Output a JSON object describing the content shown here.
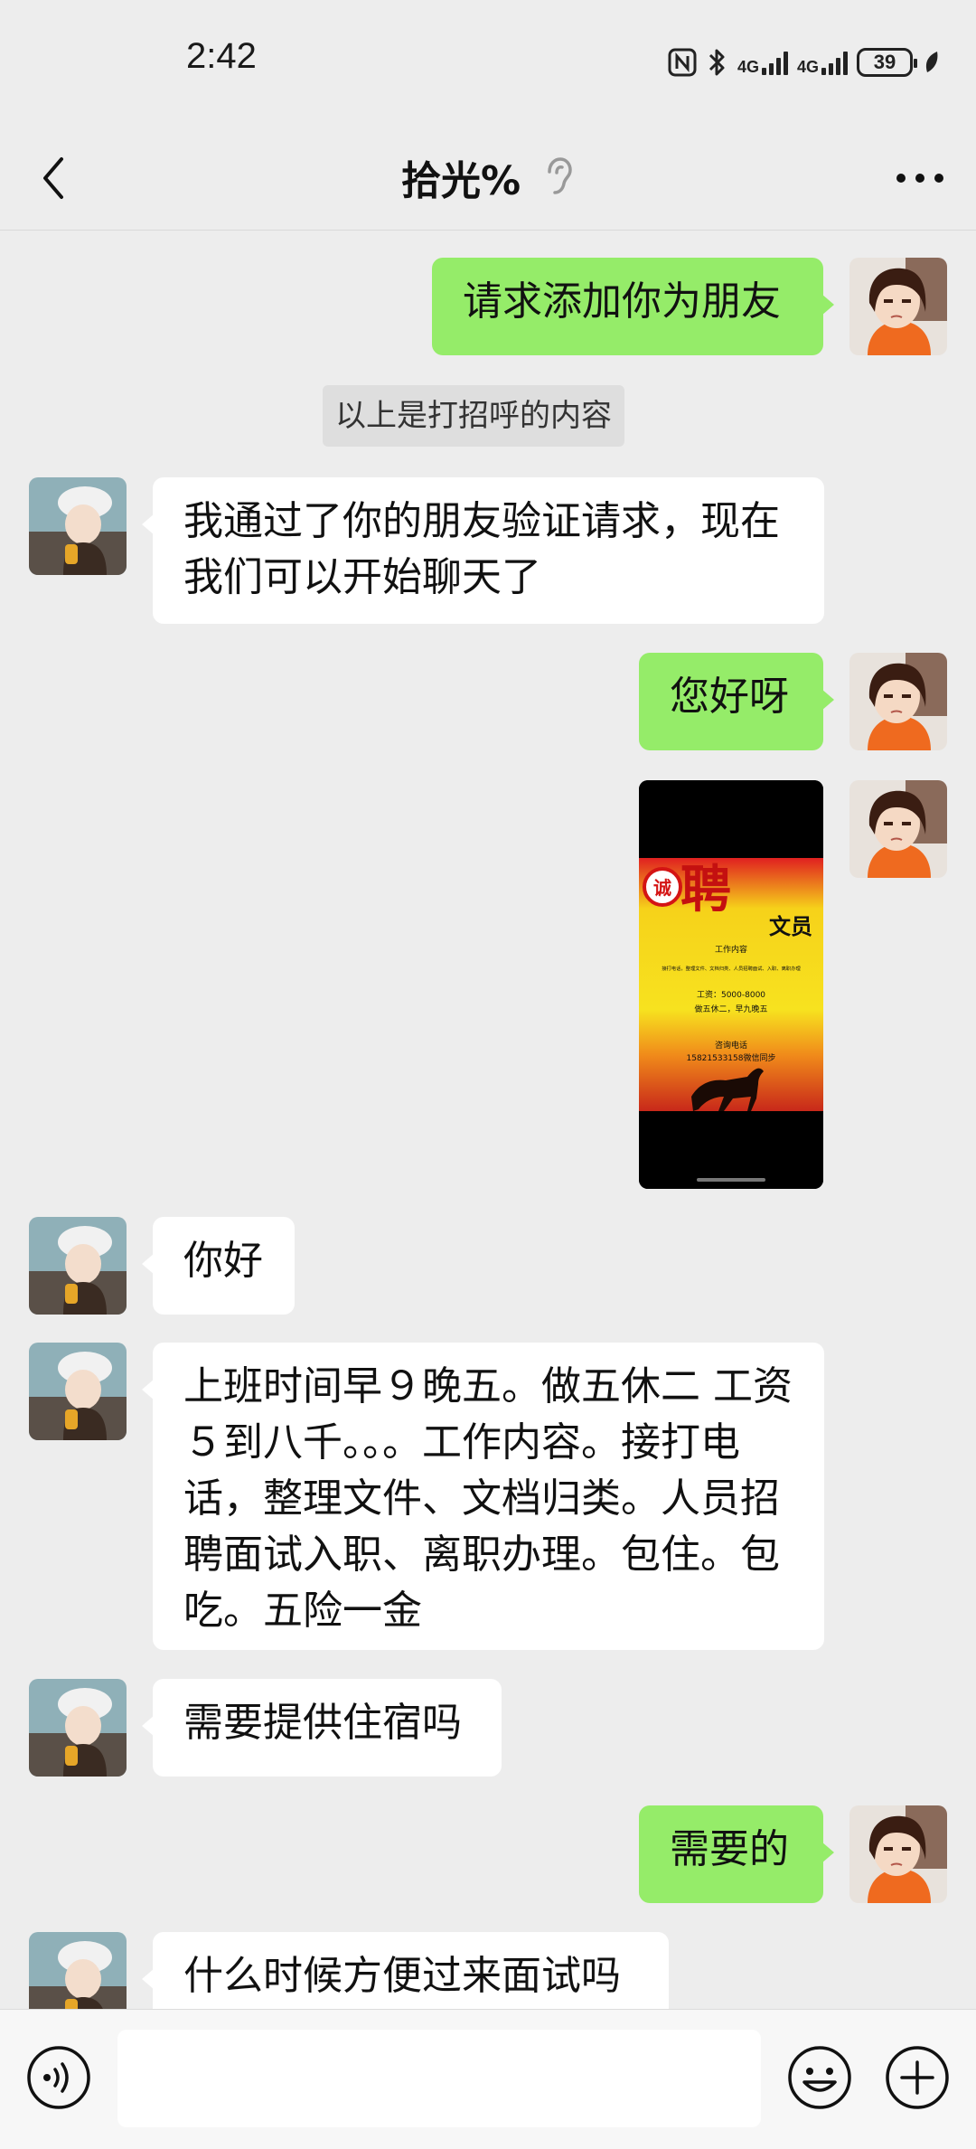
{
  "status_bar": {
    "time": "2:42",
    "network_1": "4G",
    "network_2": "4G",
    "battery": "39"
  },
  "header": {
    "title": "拾光%"
  },
  "system_note": "以上是打招呼的内容",
  "messages": [
    {
      "from": "me",
      "text": "请求添加你为朋友"
    },
    {
      "from": "them",
      "text": "我通过了你的朋友验证请求，现在我们可以开始聊天了"
    },
    {
      "from": "me",
      "text": "您好呀"
    },
    {
      "from": "me",
      "type": "image",
      "image_text": {
        "line1": "诚",
        "line2": "聘",
        "line3": "文员",
        "line4": "工作内容",
        "line5": "接打电话，整理文件、文档归类、人员招聘面试、入职、离职办理",
        "line6": "工资：5000-8000",
        "line7": "做五休二，早九晚五",
        "line8": "咨询电话",
        "line9": "15821533158微信同步"
      }
    },
    {
      "from": "them",
      "text": "你好"
    },
    {
      "from": "them",
      "text": "上班时间早９晚五。做五休二 工资５到八千。。。工作内容。接打电话，整理文件、文档归类。人员招聘面试入职、离职办理。包住。包吃。五险一金"
    },
    {
      "from": "them",
      "text": "需要提供住宿吗"
    },
    {
      "from": "me",
      "text": "需要的"
    },
    {
      "from": "them",
      "text": "什么时候方便过来面试吗"
    }
  ],
  "input": {
    "value": "",
    "placeholder": ""
  },
  "colors": {
    "background": "#ededed",
    "my_bubble": "#95ec69",
    "their_bubble": "#ffffff"
  },
  "icons": [
    "back-icon",
    "ear-icon",
    "more-icon",
    "voice-icon",
    "emoji-icon",
    "plus-icon"
  ]
}
